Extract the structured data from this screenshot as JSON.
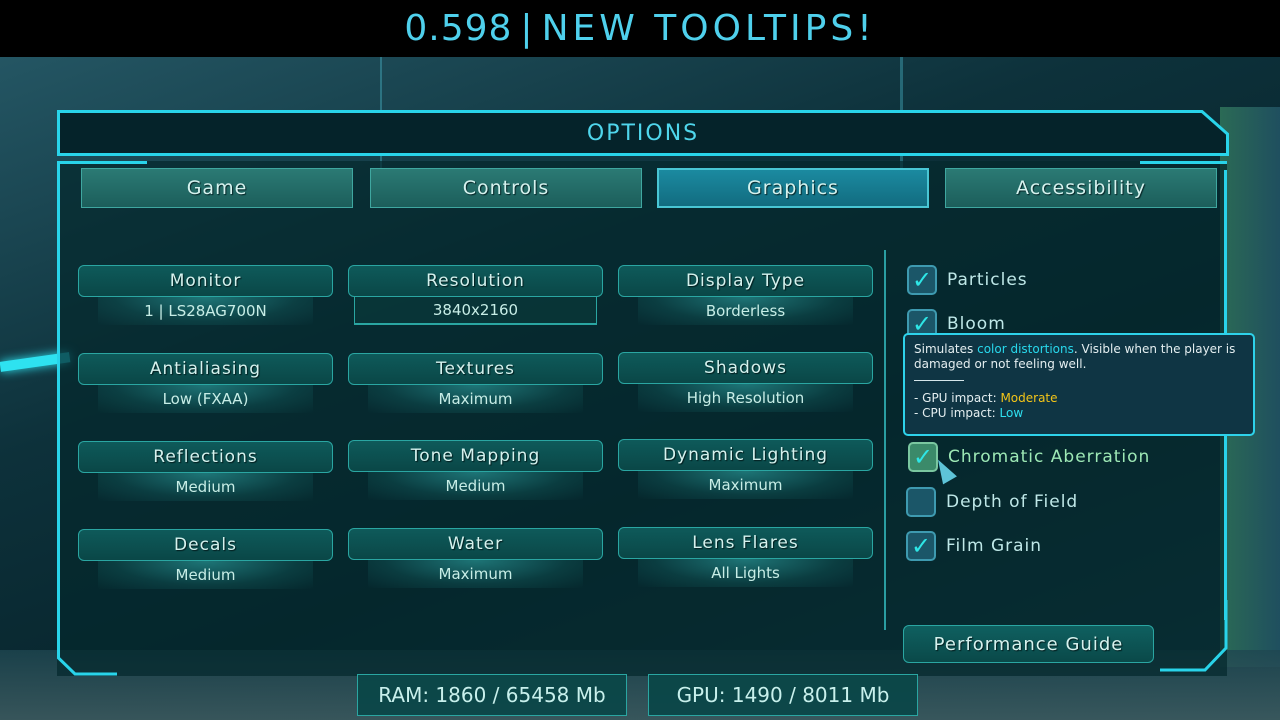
{
  "banner": {
    "version": "0.598",
    "separator": "|",
    "headline": "NEW  TOOLTIPS!"
  },
  "options": {
    "title": "OPTIONS",
    "tabs": [
      {
        "label": "Game",
        "active": false
      },
      {
        "label": "Controls",
        "active": false
      },
      {
        "label": "Graphics",
        "active": true
      },
      {
        "label": "Accessibility",
        "active": false
      }
    ],
    "settings": [
      {
        "label": "Monitor",
        "value": "1 | LS28AG700N"
      },
      {
        "label": "Resolution",
        "value": "3840x2160"
      },
      {
        "label": "Display Type",
        "value": "Borderless"
      },
      {
        "label": "Antialiasing",
        "value": "Low (FXAA)"
      },
      {
        "label": "Textures",
        "value": "Maximum"
      },
      {
        "label": "Shadows",
        "value": "High Resolution"
      },
      {
        "label": "Reflections",
        "value": "Medium"
      },
      {
        "label": "Tone Mapping",
        "value": "Medium"
      },
      {
        "label": "Dynamic Lighting",
        "value": "Maximum"
      },
      {
        "label": "Decals",
        "value": "Medium"
      },
      {
        "label": "Water",
        "value": "Maximum"
      },
      {
        "label": "Lens Flares",
        "value": "All Lights"
      }
    ],
    "toggles": [
      {
        "label": "Particles",
        "checked": true,
        "check_glyph": "✓"
      },
      {
        "label": "Bloom",
        "checked": true,
        "check_glyph": "✓"
      },
      {
        "label": "Chromatic Aberration",
        "checked": true,
        "check_glyph": "✓"
      },
      {
        "label": "Depth of Field",
        "checked": false,
        "check_glyph": ""
      },
      {
        "label": "Film Grain",
        "checked": true,
        "check_glyph": "✓"
      }
    ],
    "tooltip": {
      "prefix": "Simulates ",
      "highlight": "color distortions",
      "suffix": ". Visible when the player is damaged or not feeling well.",
      "gpu_label": "- GPU impact: ",
      "gpu_value": "Moderate",
      "cpu_label": "- CPU impact: ",
      "cpu_value": "Low"
    },
    "performance_guide_label": "Performance Guide"
  },
  "stats": {
    "ram": "RAM: 1860 / 65458 Mb",
    "gpu": "GPU: 1490 / 8011 Mb"
  },
  "colors": {
    "accent": "#29d4ea",
    "tooltip_moderate": "#f3c518",
    "tooltip_low": "#2ee0f0"
  }
}
